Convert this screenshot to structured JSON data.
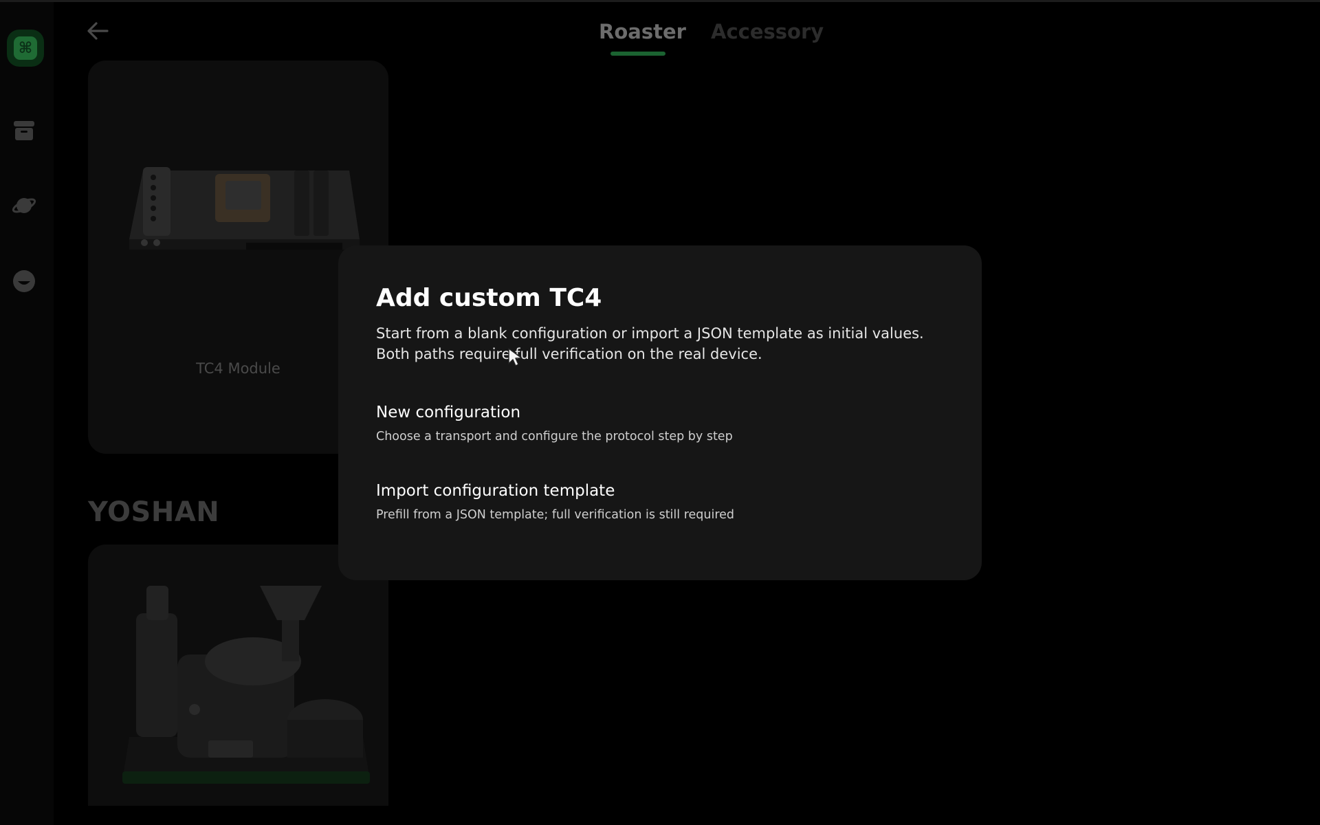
{
  "header": {
    "tabs": [
      {
        "label": "Roaster",
        "active": true
      },
      {
        "label": "Accessory",
        "active": false
      }
    ]
  },
  "sidebar": {
    "items": [
      {
        "icon": "command-icon",
        "active": true
      },
      {
        "icon": "archive-box-icon"
      },
      {
        "icon": "planet-icon"
      },
      {
        "icon": "smiley-face-icon"
      }
    ]
  },
  "cards": [
    {
      "label": "TC4 Module",
      "image": "tc4-circuit-board-image"
    }
  ],
  "sections": [
    {
      "brand": "YOSHAN",
      "image": "coffee-roaster-machine-image"
    }
  ],
  "dialog": {
    "title": "Add custom TC4",
    "description": "Start from a blank configuration or import a JSON template as initial values. Both paths require full verification on the real device.",
    "options": [
      {
        "title": "New configuration",
        "subtitle": "Choose a transport and configure the protocol step by step"
      },
      {
        "title": "Import configuration template",
        "subtitle": "Prefill from a JSON template; full verification is still required"
      }
    ]
  },
  "colors": {
    "background": "#000000",
    "dialog": "#161616",
    "accent_green": "#1b6331"
  }
}
